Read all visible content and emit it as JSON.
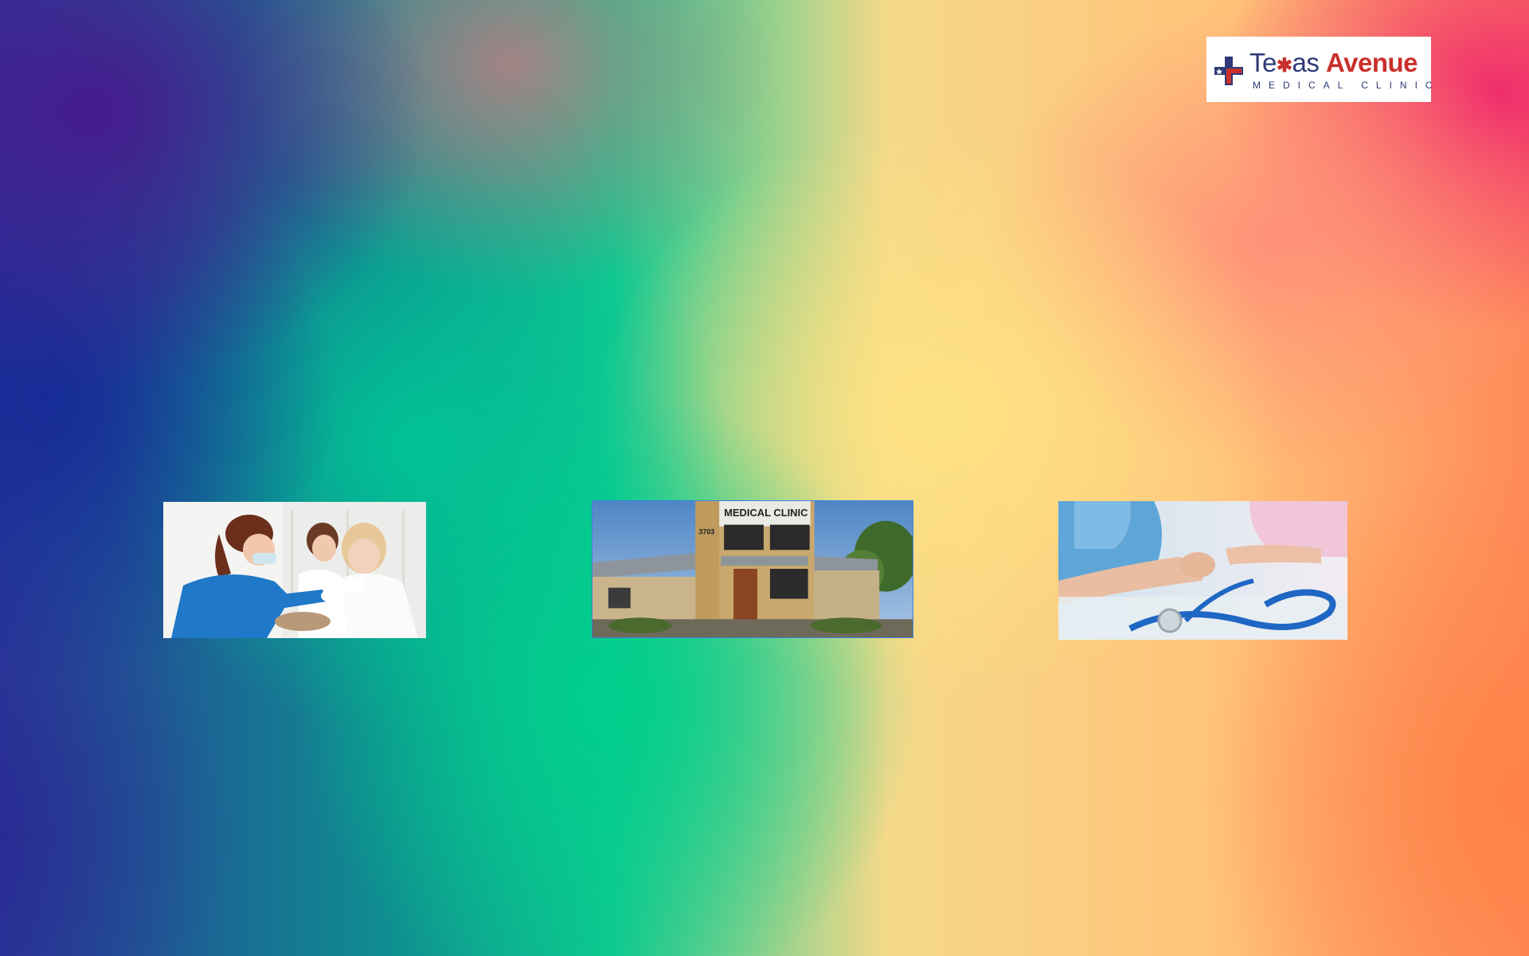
{
  "logo": {
    "word_1": "Te",
    "star": "✱",
    "word_1_end": "as",
    "word_2": "Avenue",
    "subtitle": "MEDICAL CLINIC",
    "colors": {
      "navy": "#2f3a78",
      "red": "#c9302c"
    }
  },
  "photos": [
    {
      "id": "photo-1",
      "subject": "nurse-vaccinating-child-photo"
    },
    {
      "id": "photo-2",
      "subject": "clinic-building-photo",
      "sign_text": "MEDICAL CLINIC",
      "address_number": "3703"
    },
    {
      "id": "photo-3",
      "subject": "doctor-stethoscope-photo"
    }
  ]
}
